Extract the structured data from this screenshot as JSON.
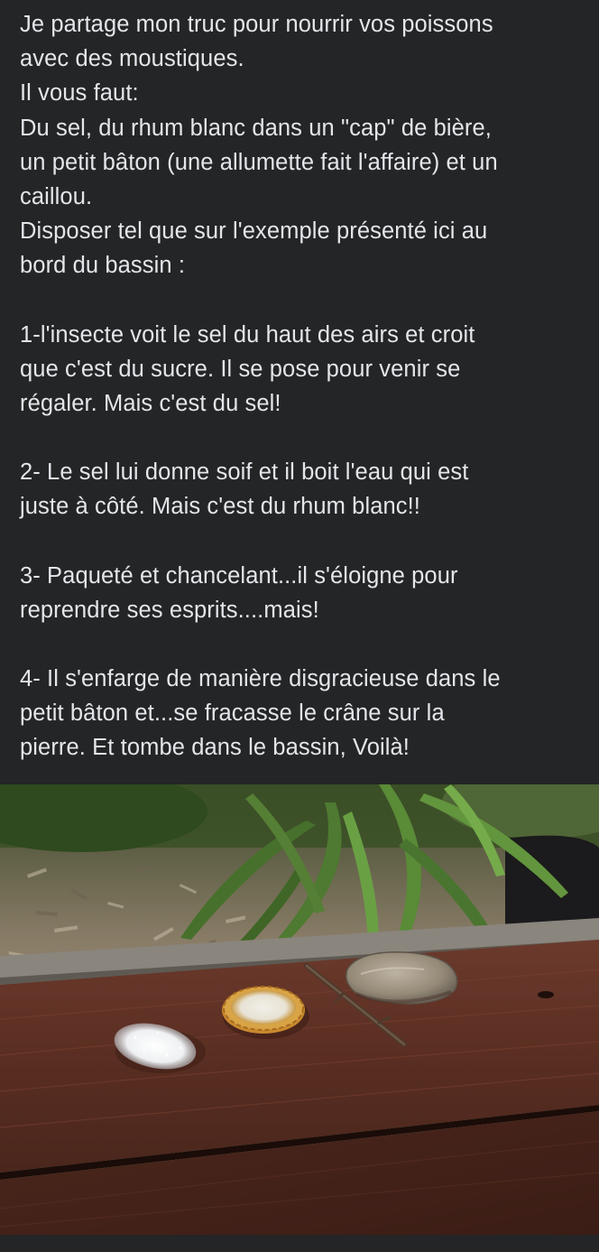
{
  "post": {
    "lines": [
      "Je partage mon truc pour nourrir vos poissons",
      "avec des moustiques.",
      "Il vous faut:",
      "Du sel, du rhum blanc dans un \"cap\" de bière,",
      "un petit bâton (une allumette fait l'affaire) et un",
      "caillou.",
      "Disposer tel que sur l'exemple présenté ici au",
      "bord du bassin :"
    ],
    "step1": [
      "1-l'insecte voit le sel du haut des airs et croit",
      "que c'est du sucre. Il se pose pour venir se",
      "régaler. Mais c'est du sel!"
    ],
    "step2": [
      "2- Le sel lui donne soif et il boit l'eau qui est",
      "juste à côté.  Mais c'est du rhum blanc!!"
    ],
    "step3": [
      "3- Paqueté et chancelant...il s'éloigne pour",
      "reprendre ses esprits....mais!"
    ],
    "step4": [
      "4- Il s'enfarge de manière disgracieuse dans le",
      "petit bâton et...se fracasse le crâne sur la",
      "pierre. Et tombe dans le bassin, Voilà!"
    ]
  },
  "colors": {
    "background": "#242526",
    "text": "#e4e6eb"
  }
}
